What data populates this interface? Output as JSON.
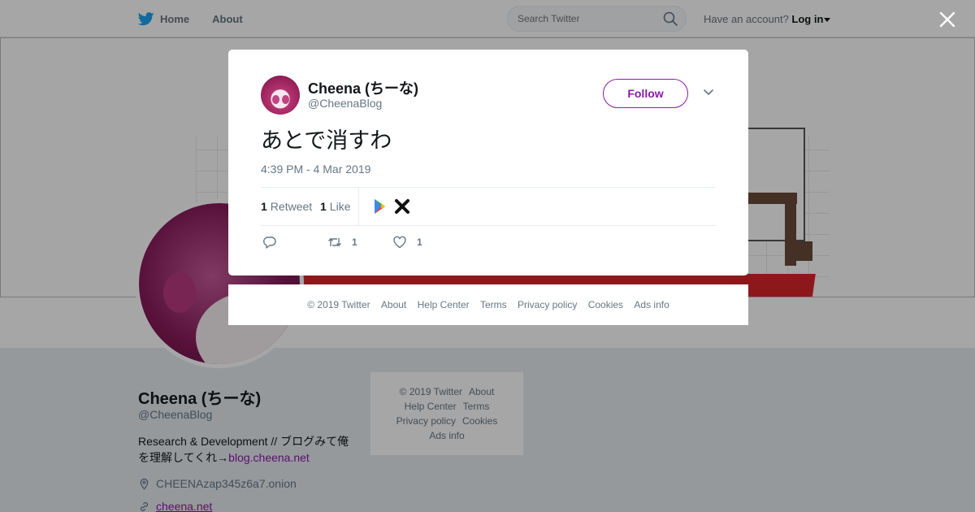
{
  "topbar": {
    "home_label": "Home",
    "about_label": "About",
    "search_placeholder": "Search Twitter",
    "account_prompt": "Have an account?",
    "login_label": "Log in"
  },
  "profile": {
    "name": "Cheena (ちーな)",
    "handle": "@CheenaBlog",
    "bio_text": "Research & Development // ブログみて俺を理解してくれ→",
    "bio_link": "blog.cheena.net",
    "location": "CHEENAzap345z6a7.onion",
    "website": "cheena.net"
  },
  "side_footer": {
    "copyright": "© 2019 Twitter",
    "about": "About",
    "help": "Help Center",
    "terms": "Terms",
    "privacy": "Privacy policy",
    "cookies": "Cookies",
    "ads": "Ads info"
  },
  "tweet": {
    "author_name": "Cheena (ちーな)",
    "author_handle": "@CheenaBlog",
    "follow_label": "Follow",
    "text": "あとで消すわ",
    "timestamp": "4:39 PM - 4 Mar 2019",
    "retweet_count": "1",
    "retweet_label": "Retweet",
    "like_count": "1",
    "like_label": "Like",
    "action_retweet_count": "1",
    "action_like_count": "1"
  },
  "modal_footer": {
    "copyright": "© 2019 Twitter",
    "about": "About",
    "help": "Help Center",
    "terms": "Terms",
    "privacy": "Privacy policy",
    "cookies": "Cookies",
    "ads": "Ads info"
  },
  "colors": {
    "accent": "#8b19a8",
    "twitter_blue": "#1da1f2",
    "muted_text": "#657786"
  }
}
